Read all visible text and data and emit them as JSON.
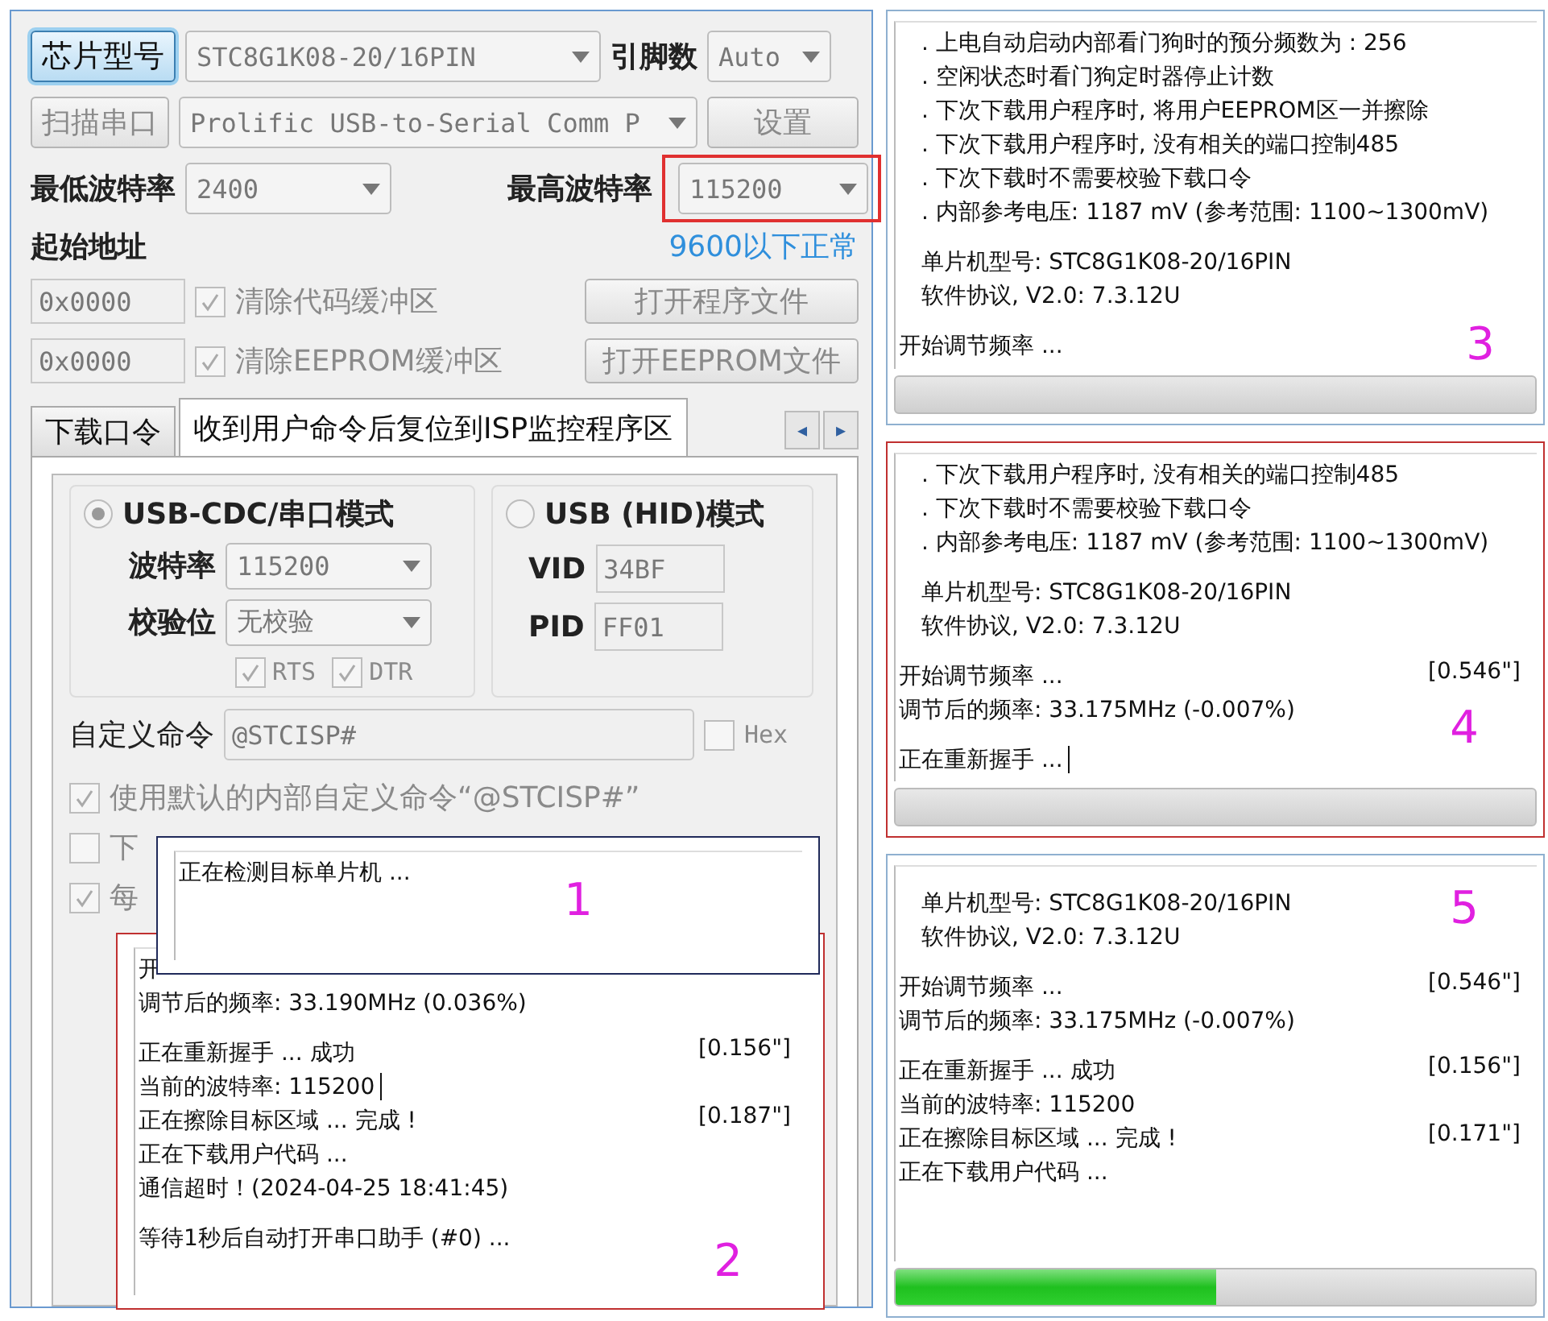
{
  "main_window": {
    "chip_button": "芯片型号",
    "chip_select": "STC8G1K08-20/16PIN",
    "pins_label": "引脚数",
    "pins_select": "Auto",
    "scan_button": "扫描串口",
    "port_select": "Prolific USB-to-Serial Comm P",
    "settings_button": "设置",
    "min_baud_label": "最低波特率",
    "min_baud_select": "2400",
    "max_baud_label": "最高波特率",
    "max_baud_select": "115200",
    "max_baud_annotated": true,
    "annotation": "9600以下正常",
    "start_address_label": "起始地址",
    "address_rows": [
      {
        "value": "0x0000",
        "checkbox_label": "清除代码缓冲区",
        "checked": true,
        "button": "打开程序文件"
      },
      {
        "value": "0x0000",
        "checkbox_label": "清除EEPROM缓冲区",
        "checked": true,
        "button": "打开EEPROM文件"
      }
    ],
    "tabs": [
      {
        "label": "下载口令",
        "selected": false
      },
      {
        "label": "收到用户命令后复位到ISP监控程序区",
        "selected": true
      }
    ],
    "tab_scroll": [
      "◂",
      "▸"
    ],
    "modes": [
      {
        "label": "USB-CDC/串口模式",
        "selected": true,
        "fields": [
          {
            "label": "波特率",
            "value": "115200",
            "kind": "select"
          },
          {
            "label": "校验位",
            "value": "无校验",
            "kind": "select"
          }
        ],
        "checks": [
          {
            "label": "RTS",
            "checked": true
          },
          {
            "label": "DTR",
            "checked": true
          }
        ]
      },
      {
        "label": "USB (HID)模式",
        "selected": false,
        "fields": [
          {
            "label": "VID",
            "value": "34BF",
            "kind": "input"
          },
          {
            "label": "PID",
            "value": "FF01",
            "kind": "input"
          }
        ]
      }
    ],
    "custom_command_label": "自定义命令",
    "custom_command_value": "@STCISP#",
    "hex": {
      "label": "Hex",
      "checked": false
    },
    "options": [
      {
        "label": "使用默认的内部自定义命令“@STCISP#”",
        "checked": true
      },
      {
        "label": "下",
        "checked": false
      },
      {
        "label": "每",
        "checked": true
      }
    ]
  },
  "popups": [
    {
      "number": "1",
      "highlight": false,
      "lines": [
        {
          "kind": "status",
          "text": "正在检测目标单片机 ..."
        }
      ]
    },
    {
      "number": "2",
      "highlight": true,
      "lines": [
        {
          "kind": "status",
          "text": "开"
        },
        {
          "kind": "status",
          "text": "调节后的频率: 33.190MHz (0.036%)"
        },
        {
          "kind": "blank"
        },
        {
          "kind": "status",
          "text": "正在重新握手 ... 成功",
          "time": "[0.156\"]"
        },
        {
          "kind": "status",
          "text": "当前的波特率: 115200",
          "cursor": true
        },
        {
          "kind": "status",
          "text": "正在擦除目标区域 ... 完成 !",
          "time": "[0.187\"]"
        },
        {
          "kind": "status",
          "text": "正在下载用户代码 ..."
        },
        {
          "kind": "status",
          "text": "通信超时！(2024-04-25 18:41:45)"
        },
        {
          "kind": "blank"
        },
        {
          "kind": "status",
          "text": "等待1秒后自动打开串口助手 (#0) ..."
        }
      ]
    }
  ],
  "log_panels": [
    {
      "number": "3",
      "highlight": false,
      "level": 0,
      "lines": [
        {
          "kind": "item",
          "text": ". 上电自动启动内部看门狗时的预分频数为 : 256"
        },
        {
          "kind": "item",
          "text": ". 空闲状态时看门狗定时器停止计数"
        },
        {
          "kind": "item",
          "text": ". 下次下载用户程序时, 将用户EEPROM区一并擦除"
        },
        {
          "kind": "item",
          "text": ". 下次下载用户程序时, 没有相关的端口控制485"
        },
        {
          "kind": "item",
          "text": ". 下次下载时不需要校验下载口令"
        },
        {
          "kind": "item",
          "text": ". 内部参考电压: 1187 mV (参考范围: 1100~1300mV)"
        },
        {
          "kind": "blank"
        },
        {
          "kind": "info",
          "text": "单片机型号: STC8G1K08-20/16PIN"
        },
        {
          "kind": "info",
          "text": "软件协议, V2.0: 7.3.12U"
        },
        {
          "kind": "blank"
        },
        {
          "kind": "status",
          "text": "开始调节频率 ..."
        }
      ]
    },
    {
      "number": "4",
      "highlight": true,
      "level": 0,
      "lines": [
        {
          "kind": "item",
          "text": ". 下次下载用户程序时, 没有相关的端口控制485"
        },
        {
          "kind": "item",
          "text": ". 下次下载时不需要校验下载口令"
        },
        {
          "kind": "item",
          "text": ". 内部参考电压: 1187 mV (参考范围: 1100~1300mV)"
        },
        {
          "kind": "blank"
        },
        {
          "kind": "info",
          "text": "单片机型号: STC8G1K08-20/16PIN"
        },
        {
          "kind": "info",
          "text": "软件协议, V2.0: 7.3.12U"
        },
        {
          "kind": "blank"
        },
        {
          "kind": "status",
          "text": "开始调节频率 ...",
          "time": "[0.546\"]"
        },
        {
          "kind": "status",
          "text": "调节后的频率: 33.175MHz (-0.007%)"
        },
        {
          "kind": "blank"
        },
        {
          "kind": "status",
          "text": "正在重新握手 ...",
          "cursor": true
        }
      ]
    },
    {
      "number": "5",
      "highlight": false,
      "level": 0.5,
      "lines": [
        {
          "kind": "blank"
        },
        {
          "kind": "info",
          "text": "单片机型号: STC8G1K08-20/16PIN"
        },
        {
          "kind": "info",
          "text": "软件协议, V2.0: 7.3.12U"
        },
        {
          "kind": "blank"
        },
        {
          "kind": "status",
          "text": "开始调节频率 ...",
          "time": "[0.546\"]"
        },
        {
          "kind": "status",
          "text": "调节后的频率: 33.175MHz (-0.007%)"
        },
        {
          "kind": "blank"
        },
        {
          "kind": "status",
          "text": "正在重新握手 ... 成功",
          "time": "[0.156\"]"
        },
        {
          "kind": "status",
          "text": "当前的波特率: 115200"
        },
        {
          "kind": "status",
          "text": "正在擦除目标区域 ... 完成 !",
          "time": "[0.171\"]"
        },
        {
          "kind": "status",
          "text": "正在下载用户代码 ..."
        }
      ]
    }
  ]
}
